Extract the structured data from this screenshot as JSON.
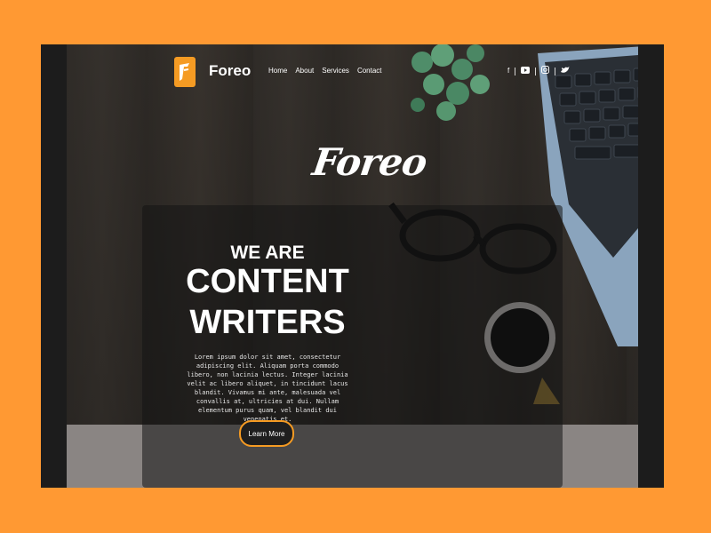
{
  "header": {
    "brand": "Foreo",
    "nav": [
      "Home",
      "About",
      "Services",
      "Contact"
    ],
    "social_icons": [
      "facebook-icon",
      "youtube-icon",
      "instagram-icon",
      "twitter-icon"
    ]
  },
  "hero": {
    "script_logo": "Foreo",
    "eyebrow": "WE ARE",
    "title_line1": "CONTENT",
    "title_line2": "WRITERS",
    "paragraph": "Lorem ipsum dolor sit amet, consectetur adipiscing elit. Aliquam porta commodo libero, non lacinia lectus. Integer lacinia velit ac libero aliquet, in tincidunt lacus blandit. Vivamus mi ante, malesuada vel convallis at, ultricies at dui. Nullam elementum purus quam, vel blandit dui venenatis et.",
    "cta": "Learn More"
  },
  "colors": {
    "accent": "#f59b23",
    "background_outer": "#ff9933"
  }
}
